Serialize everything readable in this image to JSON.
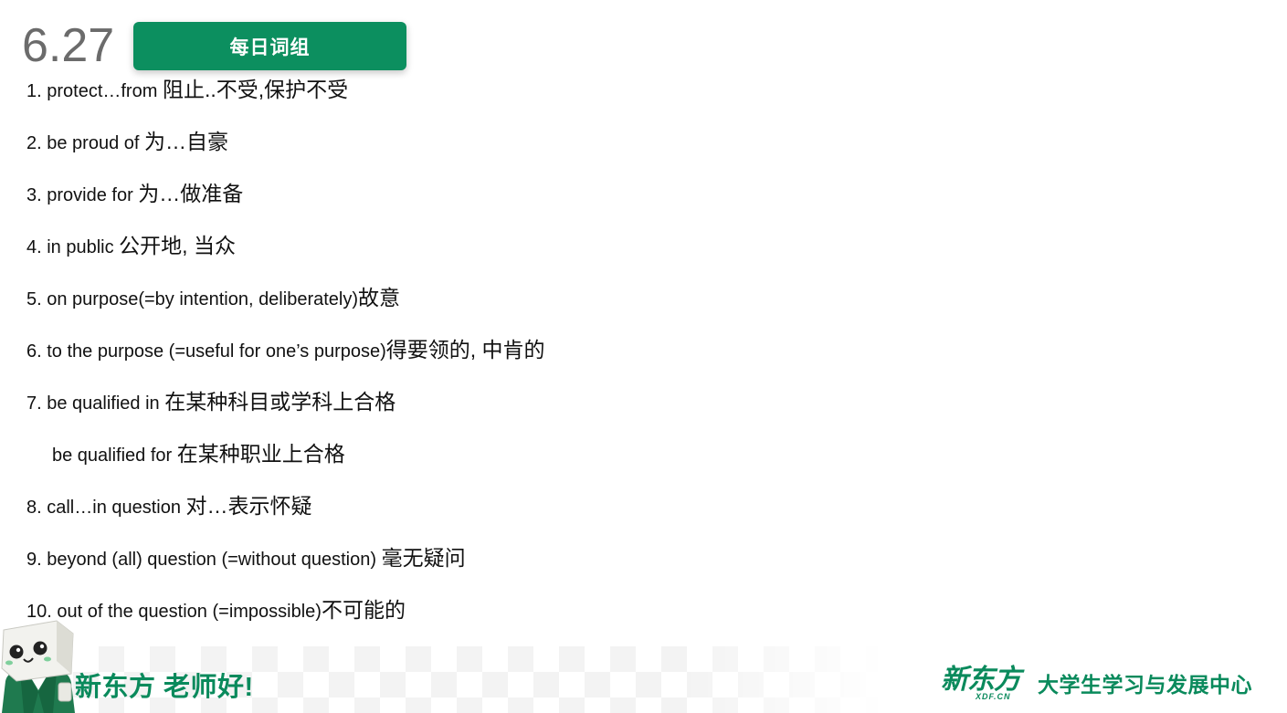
{
  "header": {
    "date": "6.27",
    "badge_label": "每日词组"
  },
  "phrases": [
    {
      "en": "1. protect…from ",
      "zh": "阻止..不受,保护不受"
    },
    {
      "en": "2. be proud of ",
      "zh": "为…自豪"
    },
    {
      "en": "3. provide for ",
      "zh": "为…做准备"
    },
    {
      "en": "4. in public ",
      "zh": "公开地, 当众"
    },
    {
      "en": "5. on purpose(=by intention, deliberately)",
      "zh": "故意"
    },
    {
      "en": "6. to the purpose (=useful for one’s purpose)",
      "zh": "得要领的, 中肯的"
    },
    {
      "en": "7. be qualified in ",
      "zh": "在某种科目或学科上合格"
    },
    {
      "en": "be qualified for ",
      "zh": "在某种职业上合格"
    },
    {
      "en": "8. call…in question ",
      "zh": "对…表示怀疑"
    },
    {
      "en": "9. beyond (all) question (=without question) ",
      "zh": "毫无疑问"
    },
    {
      "en": "10. out of the question (=impossible)",
      "zh": "不可能的"
    }
  ],
  "footer": {
    "greeting": "新东方 老师好!",
    "logo_cn": "新东方",
    "logo_en": "XDF.CN",
    "center_name": "大学生学习与发展中心"
  },
  "colors": {
    "brand_green": "#0a8a5c",
    "badge_green": "#0c8f5f",
    "date_gray": "#6b6b6b"
  }
}
